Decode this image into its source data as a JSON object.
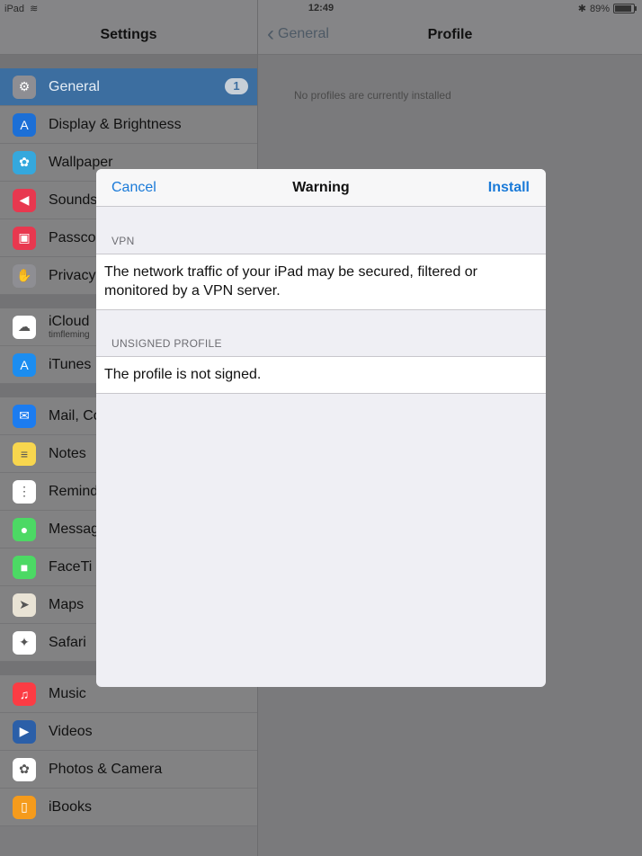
{
  "status": {
    "device": "iPad",
    "time": "12:49",
    "bluetooth": "✱",
    "battery": "89%",
    "battery_fraction": 0.89
  },
  "master": {
    "title": "Settings",
    "groups": [
      [
        {
          "label": "General",
          "icon": "gear-icon",
          "color": "#8e8e93",
          "badge": "1",
          "selected": true
        },
        {
          "label": "Display & Brightness",
          "icon": "display-icon",
          "color": "#1c6fd6"
        },
        {
          "label": "Wallpaper",
          "icon": "wallpaper-icon",
          "color": "#35a8dd"
        },
        {
          "label": "Sounds",
          "icon": "sound-icon",
          "color": "#e8384f"
        },
        {
          "label": "Passco",
          "icon": "lock-icon",
          "color": "#e8384f"
        },
        {
          "label": "Privacy",
          "icon": "hand-icon",
          "color": "#8e8e93"
        }
      ],
      [
        {
          "label": "iCloud",
          "sub": "timfleming",
          "icon": "cloud-icon",
          "color": "#ffffff"
        },
        {
          "label": "iTunes",
          "icon": "app-store-icon",
          "color": "#1c8df0"
        }
      ],
      [
        {
          "label": "Mail, Co",
          "icon": "mail-icon",
          "color": "#1c7cf0"
        },
        {
          "label": "Notes",
          "icon": "notes-icon",
          "color": "#f8d64e"
        },
        {
          "label": "Remind",
          "icon": "reminders-icon",
          "color": "#ffffff"
        },
        {
          "label": "Messag",
          "icon": "messages-icon",
          "color": "#4cd964"
        },
        {
          "label": "FaceTi",
          "icon": "facetime-icon",
          "color": "#4cd964"
        },
        {
          "label": "Maps",
          "icon": "maps-icon",
          "color": "#e9e3d5"
        },
        {
          "label": "Safari",
          "icon": "safari-icon",
          "color": "#ffffff"
        }
      ],
      [
        {
          "label": "Music",
          "icon": "music-icon",
          "color": "#fc3c44"
        },
        {
          "label": "Videos",
          "icon": "videos-icon",
          "color": "#2b5fa8"
        },
        {
          "label": "Photos & Camera",
          "icon": "photos-icon",
          "color": "#ffffff"
        },
        {
          "label": "iBooks",
          "icon": "ibooks-icon",
          "color": "#f59b1c"
        }
      ]
    ]
  },
  "detail": {
    "back_label": "General",
    "title": "Profile",
    "empty_message": "No profiles are currently installed"
  },
  "modal": {
    "cancel": "Cancel",
    "title": "Warning",
    "install": "Install",
    "section1_header": "VPN",
    "section1_text": "The network traffic of your iPad may be secured, filtered or monitored by a VPN server.",
    "section2_header": "UNSIGNED PROFILE",
    "section2_text": "The profile is not signed."
  }
}
